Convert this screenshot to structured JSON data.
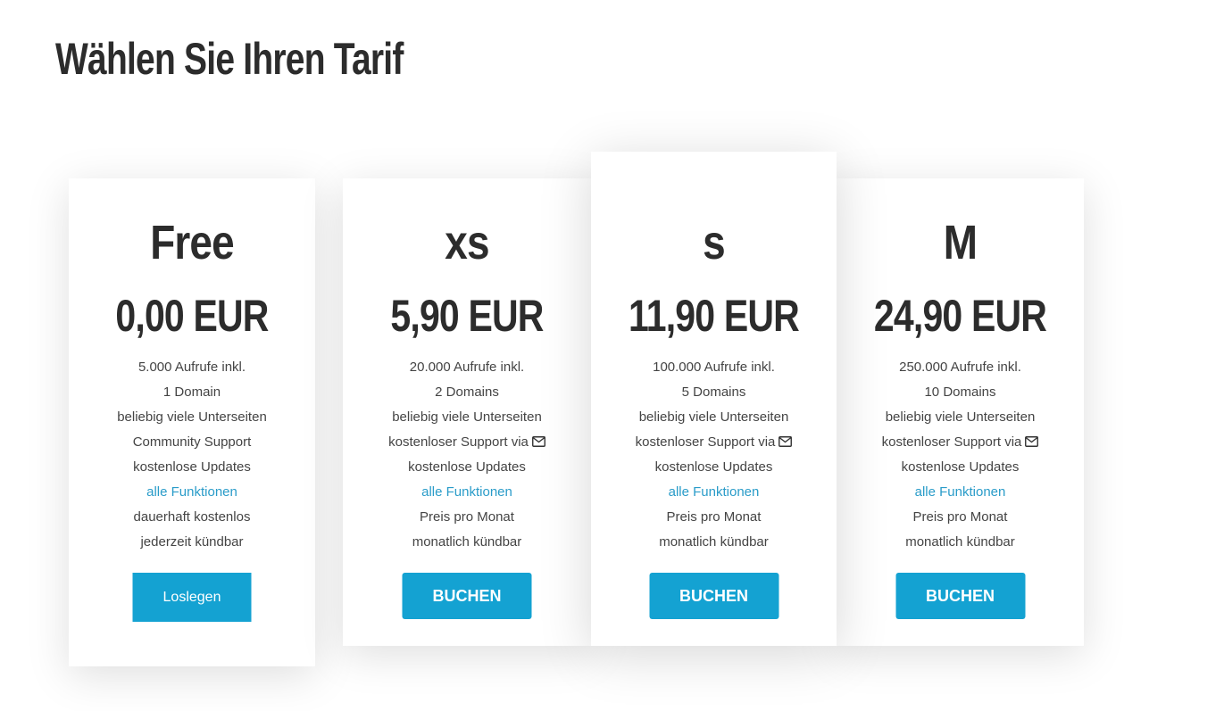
{
  "page": {
    "title": "Wählen Sie Ihren Tarif"
  },
  "colors": {
    "accent": "#14a2d2",
    "link": "#2a9cc9",
    "heading": "#2c2c2c",
    "text": "#444444"
  },
  "plans": [
    {
      "name": "Free",
      "price": "0,00 EUR",
      "features": [
        "5.000 Aufrufe inkl.",
        "1 Domain",
        "beliebig viele Unterseiten",
        "Community Support",
        "kostenlose Updates",
        "alle Funktionen",
        "dauerhaft kostenlos",
        "jederzeit kündbar"
      ],
      "button_label": "Loslegen"
    },
    {
      "name": "xs",
      "price": "5,90 EUR",
      "features": [
        "20.000 Aufrufe inkl.",
        "2 Domains",
        "beliebig viele Unterseiten",
        "kostenloser Support via",
        "kostenlose Updates",
        "alle Funktionen",
        "Preis pro Monat",
        "monatlich kündbar"
      ],
      "button_label": "BUCHEN"
    },
    {
      "name": "s",
      "price": "11,90 EUR",
      "features": [
        "100.000 Aufrufe inkl.",
        "5 Domains",
        "beliebig viele Unterseiten",
        "kostenloser Support via",
        "kostenlose Updates",
        "alle Funktionen",
        "Preis pro Monat",
        "monatlich kündbar"
      ],
      "button_label": "BUCHEN"
    },
    {
      "name": "M",
      "price": "24,90 EUR",
      "features": [
        "250.000 Aufrufe inkl.",
        "10 Domains",
        "beliebig viele Unterseiten",
        "kostenloser Support via",
        "kostenlose Updates",
        "alle Funktionen",
        "Preis pro Monat",
        "monatlich kündbar"
      ],
      "button_label": "BUCHEN"
    }
  ],
  "icons": {
    "support_icon": "envelope-icon"
  }
}
